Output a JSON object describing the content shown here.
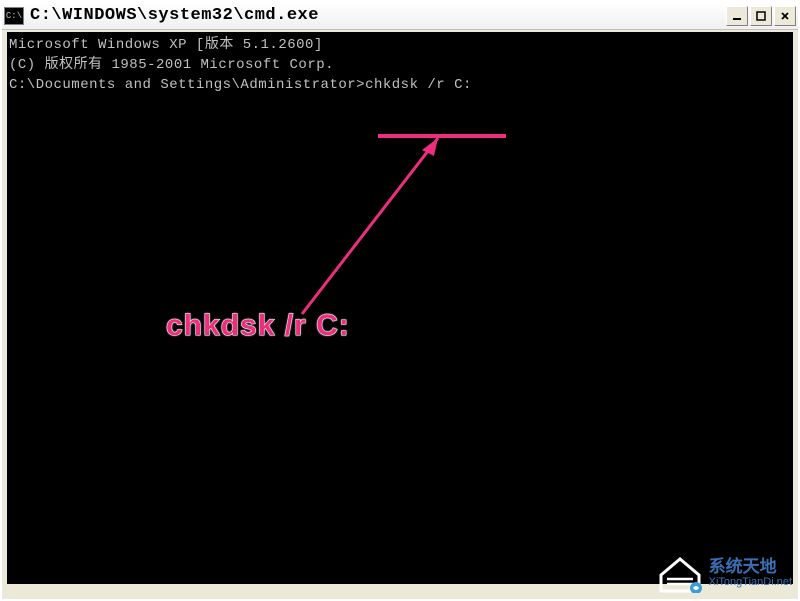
{
  "window": {
    "title": "C:\\WINDOWS\\system32\\cmd.exe",
    "icon_text": "C:\\"
  },
  "terminal": {
    "line1": "Microsoft Windows XP [版本 5.1.2600]",
    "line2": "(C) 版权所有 1985-2001 Microsoft Corp.",
    "blank": "",
    "prompt": "C:\\Documents and Settings\\Administrator>",
    "command": "chkdsk /r C:"
  },
  "annotation": {
    "label": "chkdsk /r C:",
    "underline_color": "#ed2e7c"
  },
  "watermark": {
    "title": "系统天地",
    "url": "XiTongTianDi.net"
  }
}
